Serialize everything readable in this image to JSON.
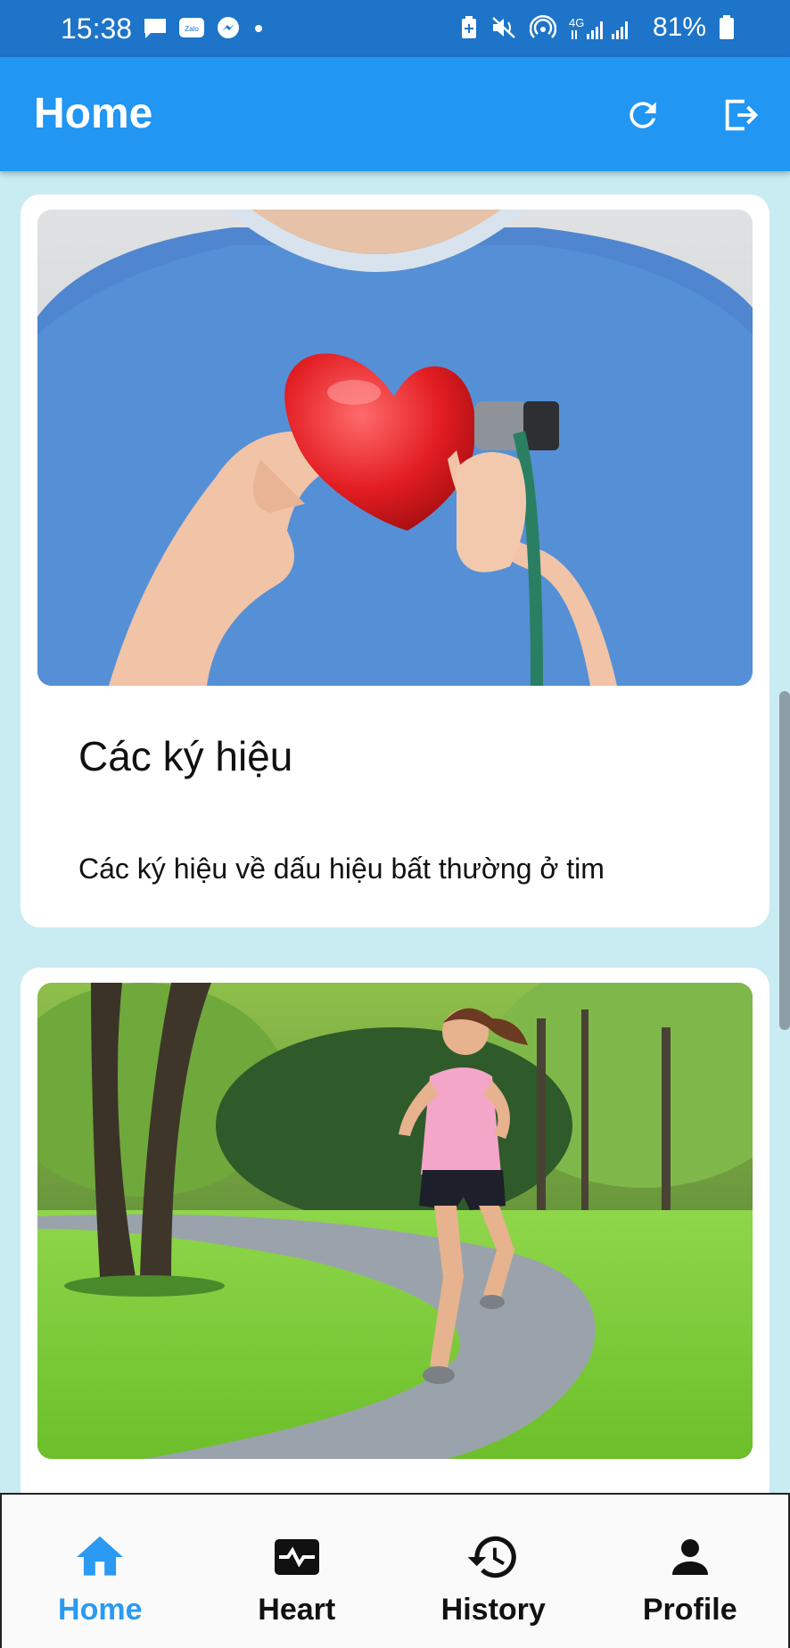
{
  "status_bar": {
    "time": "15:38",
    "battery": "81%",
    "network": "4G",
    "left_icons": [
      "chat-icon",
      "zalo-icon",
      "messenger-icon",
      "dot-icon"
    ],
    "right_icons": [
      "battery-saver-icon",
      "mute-icon",
      "hotspot-icon",
      "signal-icon",
      "battery-icon"
    ]
  },
  "app_bar": {
    "title": "Home",
    "actions": [
      "refresh-icon",
      "logout-icon"
    ]
  },
  "cards": [
    {
      "image": "heart-stethoscope-photo",
      "title": "Các ký hiệu",
      "description": "Các ký hiệu về dấu hiệu bất thường ở tim"
    },
    {
      "image": "woman-running-park-photo",
      "title": "",
      "description": ""
    }
  ],
  "bottom_nav": {
    "items": [
      {
        "label": "Home",
        "icon": "home-icon",
        "active": true
      },
      {
        "label": "Heart",
        "icon": "heart-monitor-icon",
        "active": false
      },
      {
        "label": "History",
        "icon": "history-icon",
        "active": false
      },
      {
        "label": "Profile",
        "icon": "person-icon",
        "active": false
      }
    ]
  },
  "colors": {
    "app_bar": "#2196f3",
    "status_bar": "#1d74c8",
    "background": "#c9ebf2",
    "nav_active": "#2a9af3"
  }
}
